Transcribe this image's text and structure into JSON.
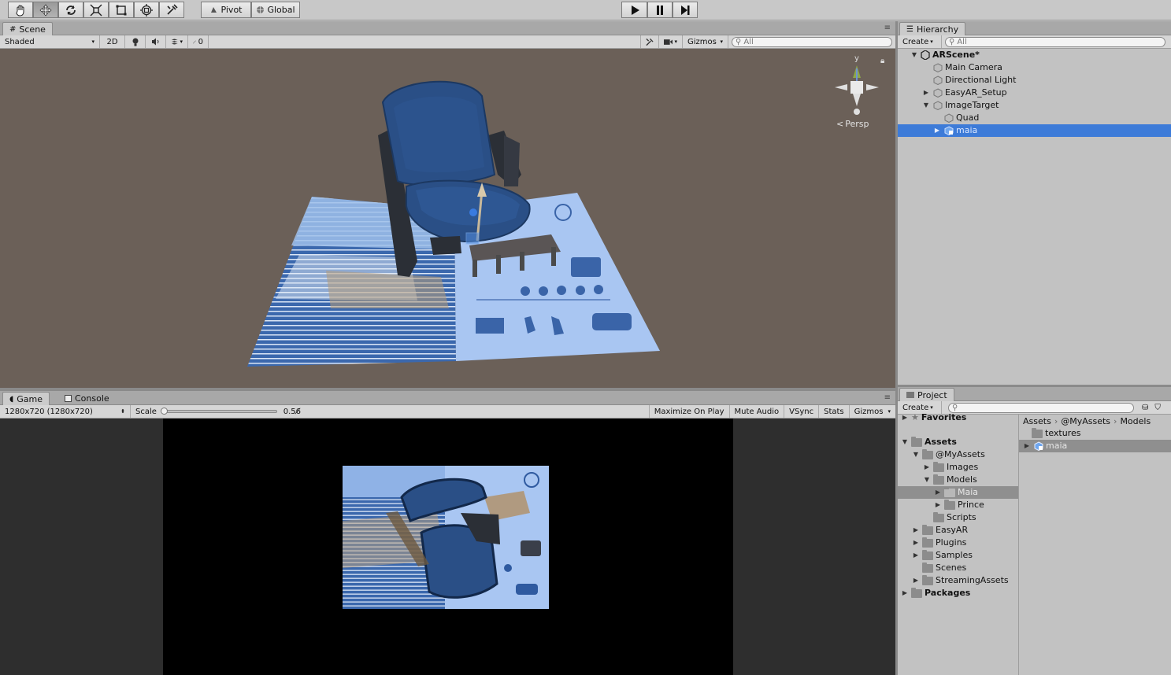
{
  "toolbar": {
    "tools": [
      "hand-tool-icon",
      "move-tool-icon",
      "rotate-tool-icon",
      "scale-tool-icon",
      "rect-tool-icon",
      "transform-tool-icon",
      "custom-tool-icon"
    ],
    "pivot_label": "Pivot",
    "global_label": "Global",
    "play_icon": "play-icon",
    "pause_icon": "pause-icon",
    "step_icon": "step-icon"
  },
  "scene": {
    "tab_label": "Scene",
    "shading": "Shaded",
    "mode_2d": "2D",
    "fx_count": "0",
    "gizmos_label": "Gizmos",
    "search_placeholder": "All",
    "persp_label": "Persp",
    "axis_y": "y"
  },
  "hierarchy": {
    "tab_label": "Hierarchy",
    "create_label": "Create",
    "search_placeholder": "All",
    "items": [
      {
        "label": "ARScene*"
      },
      {
        "label": "Main Camera"
      },
      {
        "label": "Directional Light"
      },
      {
        "label": "EasyAR_Setup"
      },
      {
        "label": "ImageTarget"
      },
      {
        "label": "Quad"
      },
      {
        "label": "maia"
      }
    ]
  },
  "game": {
    "tab_label": "Game",
    "console_label": "Console",
    "resolution": "1280x720 (1280x720)",
    "scale_label": "Scale",
    "scale_value": "0.56̸",
    "scale_fraction": 0.0,
    "maximize_label": "Maximize On Play",
    "mute_label": "Mute Audio",
    "vsync_label": "VSync",
    "stats_label": "Stats",
    "gizmos_label": "Gizmos"
  },
  "project": {
    "tab_label": "Project",
    "create_label": "Create",
    "favorites_label": "Favorites",
    "tree": [
      {
        "label": "Assets"
      },
      {
        "label": "@MyAssets"
      },
      {
        "label": "Images"
      },
      {
        "label": "Models"
      },
      {
        "label": "Maia"
      },
      {
        "label": "Prince"
      },
      {
        "label": "Scripts"
      },
      {
        "label": "EasyAR"
      },
      {
        "label": "Plugins"
      },
      {
        "label": "Samples"
      },
      {
        "label": "Scenes"
      },
      {
        "label": "StreamingAssets"
      },
      {
        "label": "Packages"
      }
    ],
    "breadcrumb": [
      "Assets",
      "@MyAssets",
      "Models"
    ],
    "files": [
      {
        "label": "textures"
      },
      {
        "label": "maia"
      }
    ]
  },
  "colors": {
    "scene_bg": "#6b6058",
    "selection": "#3d7bd8",
    "seat_blue": "#2a4f86",
    "game_bg": "#000000"
  }
}
